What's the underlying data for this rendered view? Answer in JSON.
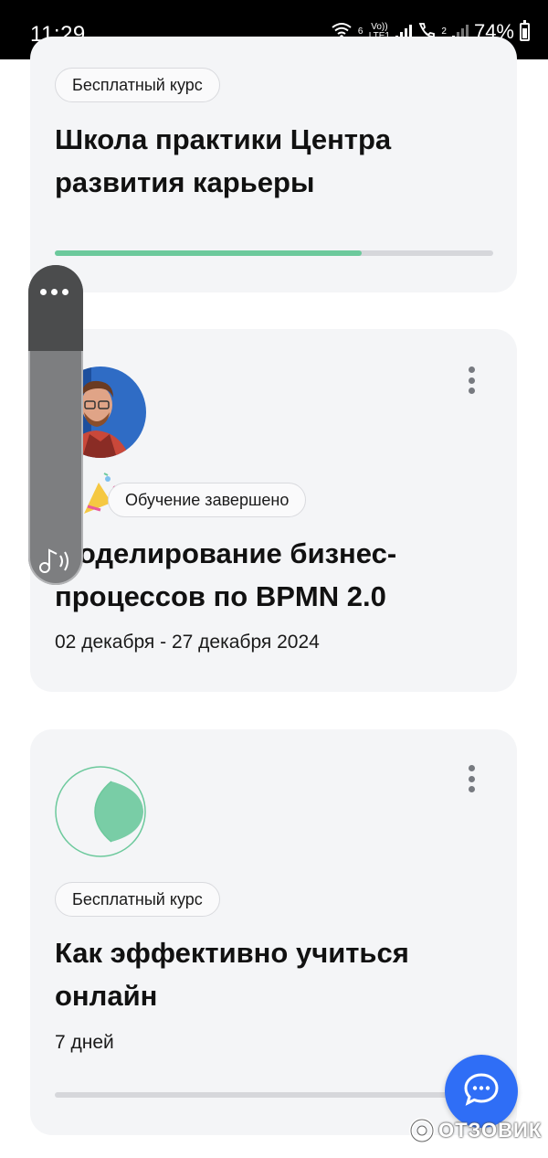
{
  "status_bar": {
    "time": "11:29",
    "wifi_label": "6",
    "volte_label": "Vo)) LTE1",
    "sim2_label": "2",
    "battery": "74%"
  },
  "cards": [
    {
      "badge": "Бесплатный курс",
      "title_lines": [
        "Школа практики Центра",
        "развития карьеры"
      ],
      "progress": 0.7
    },
    {
      "badge": "Обучение завершено",
      "title_lines": [
        "Моделирование бизнес-",
        "процессов по BPMN 2.0"
      ],
      "dates": "02 декабря - 27 декабря 2024"
    },
    {
      "badge": "Бесплатный курс",
      "title_lines": [
        "Как эффективно учиться",
        "онлайн"
      ],
      "duration": "7 дней",
      "progress": 0.0
    }
  ],
  "watermark": "ОТЗОВИК",
  "colors": {
    "accent_green": "#6cc99c",
    "fab_blue": "#2f6ef6",
    "card_bg": "#f4f5f7"
  },
  "icons": [
    "wifi-icon",
    "signal-icon",
    "battery-icon",
    "kebab-menu-icon",
    "more-dots-icon",
    "audio-icon",
    "chat-icon"
  ]
}
